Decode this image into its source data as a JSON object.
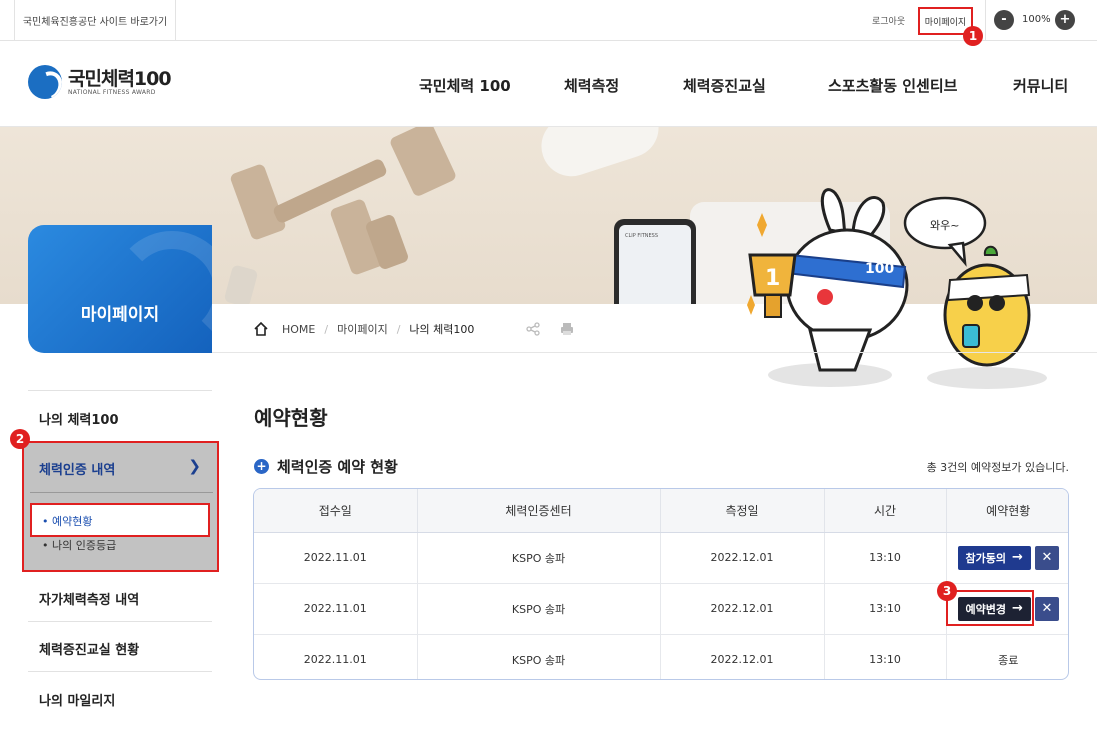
{
  "topbar": {
    "shortcut": "국민체육진흥공단 사이트 바로가기",
    "logout": "로그아웃",
    "mypage": "마이페이지",
    "zoom_minus": "-",
    "zoom_value": "100%",
    "zoom_plus": "+"
  },
  "badges": [
    "1",
    "2",
    "3"
  ],
  "logo": {
    "title": "국민체력100",
    "subtitle": "NATIONAL FITNESS AWARD"
  },
  "gnb": [
    "국민체력 100",
    "체력측정",
    "체력증진교실",
    "스포츠활동 인센티브",
    "커뮤니티"
  ],
  "hero": {
    "side_title": "마이페이지",
    "speech": "와우~",
    "phone_brand": "CLIP FITNESS",
    "headband_text": "100",
    "trophy_text": "1"
  },
  "breadcrumb": {
    "home": "HOME",
    "level1": "마이페이지",
    "current": "나의 체력100"
  },
  "lnb": {
    "item1": "나의 체력100",
    "active": "체력인증 내역",
    "sub1": "• 예약현황",
    "sub2": "• 나의 인증등급",
    "item3": "자가체력측정 내역",
    "item4": "체력증진교실 현황",
    "item5": "나의 마일리지"
  },
  "main": {
    "page_title": "예약현황",
    "section_title": "체력인증 예약 현황",
    "plus_icon": "+",
    "count_text": "총 3건의 예약정보가 있습니다."
  },
  "table": {
    "headers": [
      "접수일",
      "체력인증센터",
      "측정일",
      "시간",
      "예약현황"
    ],
    "rows": [
      {
        "received": "2022.11.01",
        "center": "KSPO 송파",
        "date": "2022.12.01",
        "time": "13:10",
        "action": "참가동의",
        "cancel": "✕"
      },
      {
        "received": "2022.11.01",
        "center": "KSPO 송파",
        "date": "2022.12.01",
        "time": "13:10",
        "action": "예약변경",
        "cancel": "✕"
      },
      {
        "received": "2022.11.01",
        "center": "KSPO 송파",
        "date": "2022.12.01",
        "time": "13:10",
        "status": "종료"
      }
    ]
  },
  "colors": {
    "accent_blue": "#1f3a8f",
    "highlight_red": "#e02020",
    "side_title_blue": "#1b6ec2"
  }
}
